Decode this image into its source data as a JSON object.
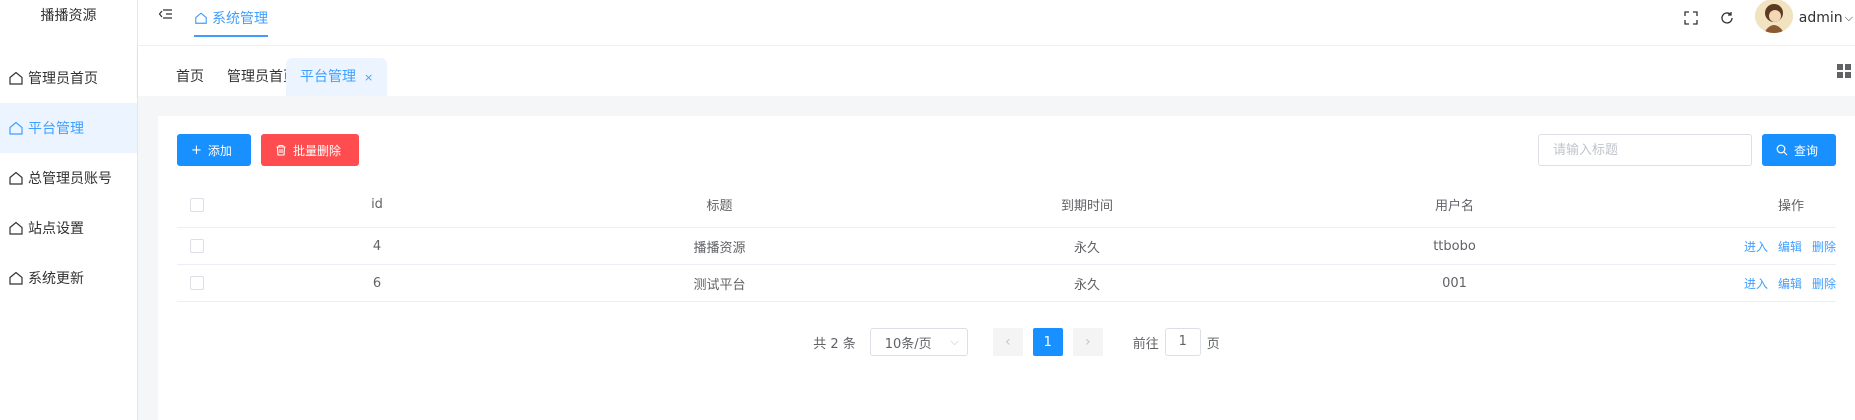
{
  "sidebar": {
    "logo": "播播资源",
    "items": [
      {
        "label": "管理员首页",
        "icon": "home-icon",
        "active": false
      },
      {
        "label": "平台管理",
        "icon": "home-icon",
        "active": true
      },
      {
        "label": "总管理员账号",
        "icon": "home-icon",
        "active": false
      },
      {
        "label": "站点设置",
        "icon": "home-icon",
        "active": false
      },
      {
        "label": "系统更新",
        "icon": "home-icon",
        "active": false
      }
    ]
  },
  "header": {
    "collapse_icon": "indent-icon",
    "tab_label": "系统管理",
    "fullscreen_icon": "fullscreen-icon",
    "refresh_icon": "refresh-icon",
    "username": "admin"
  },
  "tags": {
    "items": [
      {
        "label": "首页",
        "active": false
      },
      {
        "label": "管理员首页",
        "active": false
      },
      {
        "label": "平台管理",
        "active": true
      }
    ],
    "close_glyph": "×"
  },
  "toolbar": {
    "add_label": "添加",
    "batch_delete_label": "批量删除",
    "search_placeholder": "请输入标题",
    "search_value": "",
    "query_label": "查询"
  },
  "table": {
    "columns": [
      "id",
      "标题",
      "到期时间",
      "用户名",
      "操作"
    ],
    "rows": [
      {
        "id": "4",
        "title": "播播资源",
        "expire": "永久",
        "username": "ttbobo"
      },
      {
        "id": "6",
        "title": "测试平台",
        "expire": "永久",
        "username": "001"
      }
    ],
    "actions": {
      "enter": "进入",
      "edit": "编辑",
      "delete": "删除"
    }
  },
  "pagination": {
    "total_text": "共 2 条",
    "page_size": "10条/页",
    "current_page": "1",
    "goto_prefix": "前往",
    "goto_value": "1",
    "goto_suffix": "页"
  },
  "colors": {
    "primary": "#1890ff",
    "danger": "#ff4d4f",
    "active_bg": "#ecf5ff"
  }
}
